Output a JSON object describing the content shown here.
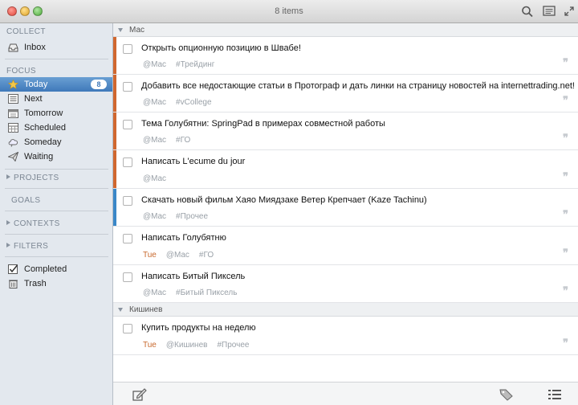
{
  "window": {
    "title": "8 items"
  },
  "sidebar": {
    "collect_label": "COLLECT",
    "inbox_label": "Inbox",
    "focus_label": "FOCUS",
    "focus_items": [
      {
        "label": "Today",
        "badge": "8"
      },
      {
        "label": "Next"
      },
      {
        "label": "Tomorrow"
      },
      {
        "label": "Scheduled"
      },
      {
        "label": "Someday"
      },
      {
        "label": "Waiting"
      }
    ],
    "projects_label": "PROJECTS",
    "goals_label": "GOALS",
    "contexts_label": "CONTEXTS",
    "filters_label": "FILTERS",
    "completed_label": "Completed",
    "trash_label": "Trash"
  },
  "groups": [
    {
      "name": "Мас"
    },
    {
      "name": "Кишинев"
    }
  ],
  "tasks": [
    {
      "title": "Открыть опционную позицию в Швабе!",
      "context": "@Mac",
      "tag": "#Трейдинг",
      "color": "#d0672f"
    },
    {
      "title": "Добавить все недостающие статьи в Протограф и дать линки на страницу новостей на internettrading.net!",
      "context": "@Mac",
      "tag": "#vCollege",
      "color": "#d0672f"
    },
    {
      "title": "Тема Голубятни: SpringPad в примерах совместной работы",
      "context": "@Mac",
      "tag": "#ГО",
      "color": "#d0672f"
    },
    {
      "title": "Написать L'ecume du jour",
      "context": "@Mac",
      "color": "#d0672f"
    },
    {
      "title": "Скачать новый фильм Хаяо Миядзаке Ветер Крепчает (Kaze Tachinu)",
      "context": "@Mac",
      "tag": "#Прочее",
      "color": "#3a87c8"
    },
    {
      "title": "Написать Голубятню",
      "due": "Tue",
      "context": "@Mac",
      "tag": "#ГО"
    },
    {
      "title": "Написать Битый Пиксель",
      "context": "@Mac",
      "tag": "#Битый Пиксель"
    },
    {
      "title": "Купить продукты на неделю",
      "due": "Tue",
      "context": "@Кишинев",
      "tag": "#Прочее"
    }
  ],
  "quote_glyph": "❞",
  "icons": {
    "toolbar": [
      "search-icon",
      "notes-icon",
      "fullscreen-icon"
    ],
    "bottom": [
      "new-task-icon",
      "tag-icon",
      "list-view-icon"
    ]
  },
  "colors": {
    "selection": "#3f79ba",
    "orange_flag": "#d0672f",
    "blue_flag": "#3a87c8",
    "due": "#c8682c"
  }
}
